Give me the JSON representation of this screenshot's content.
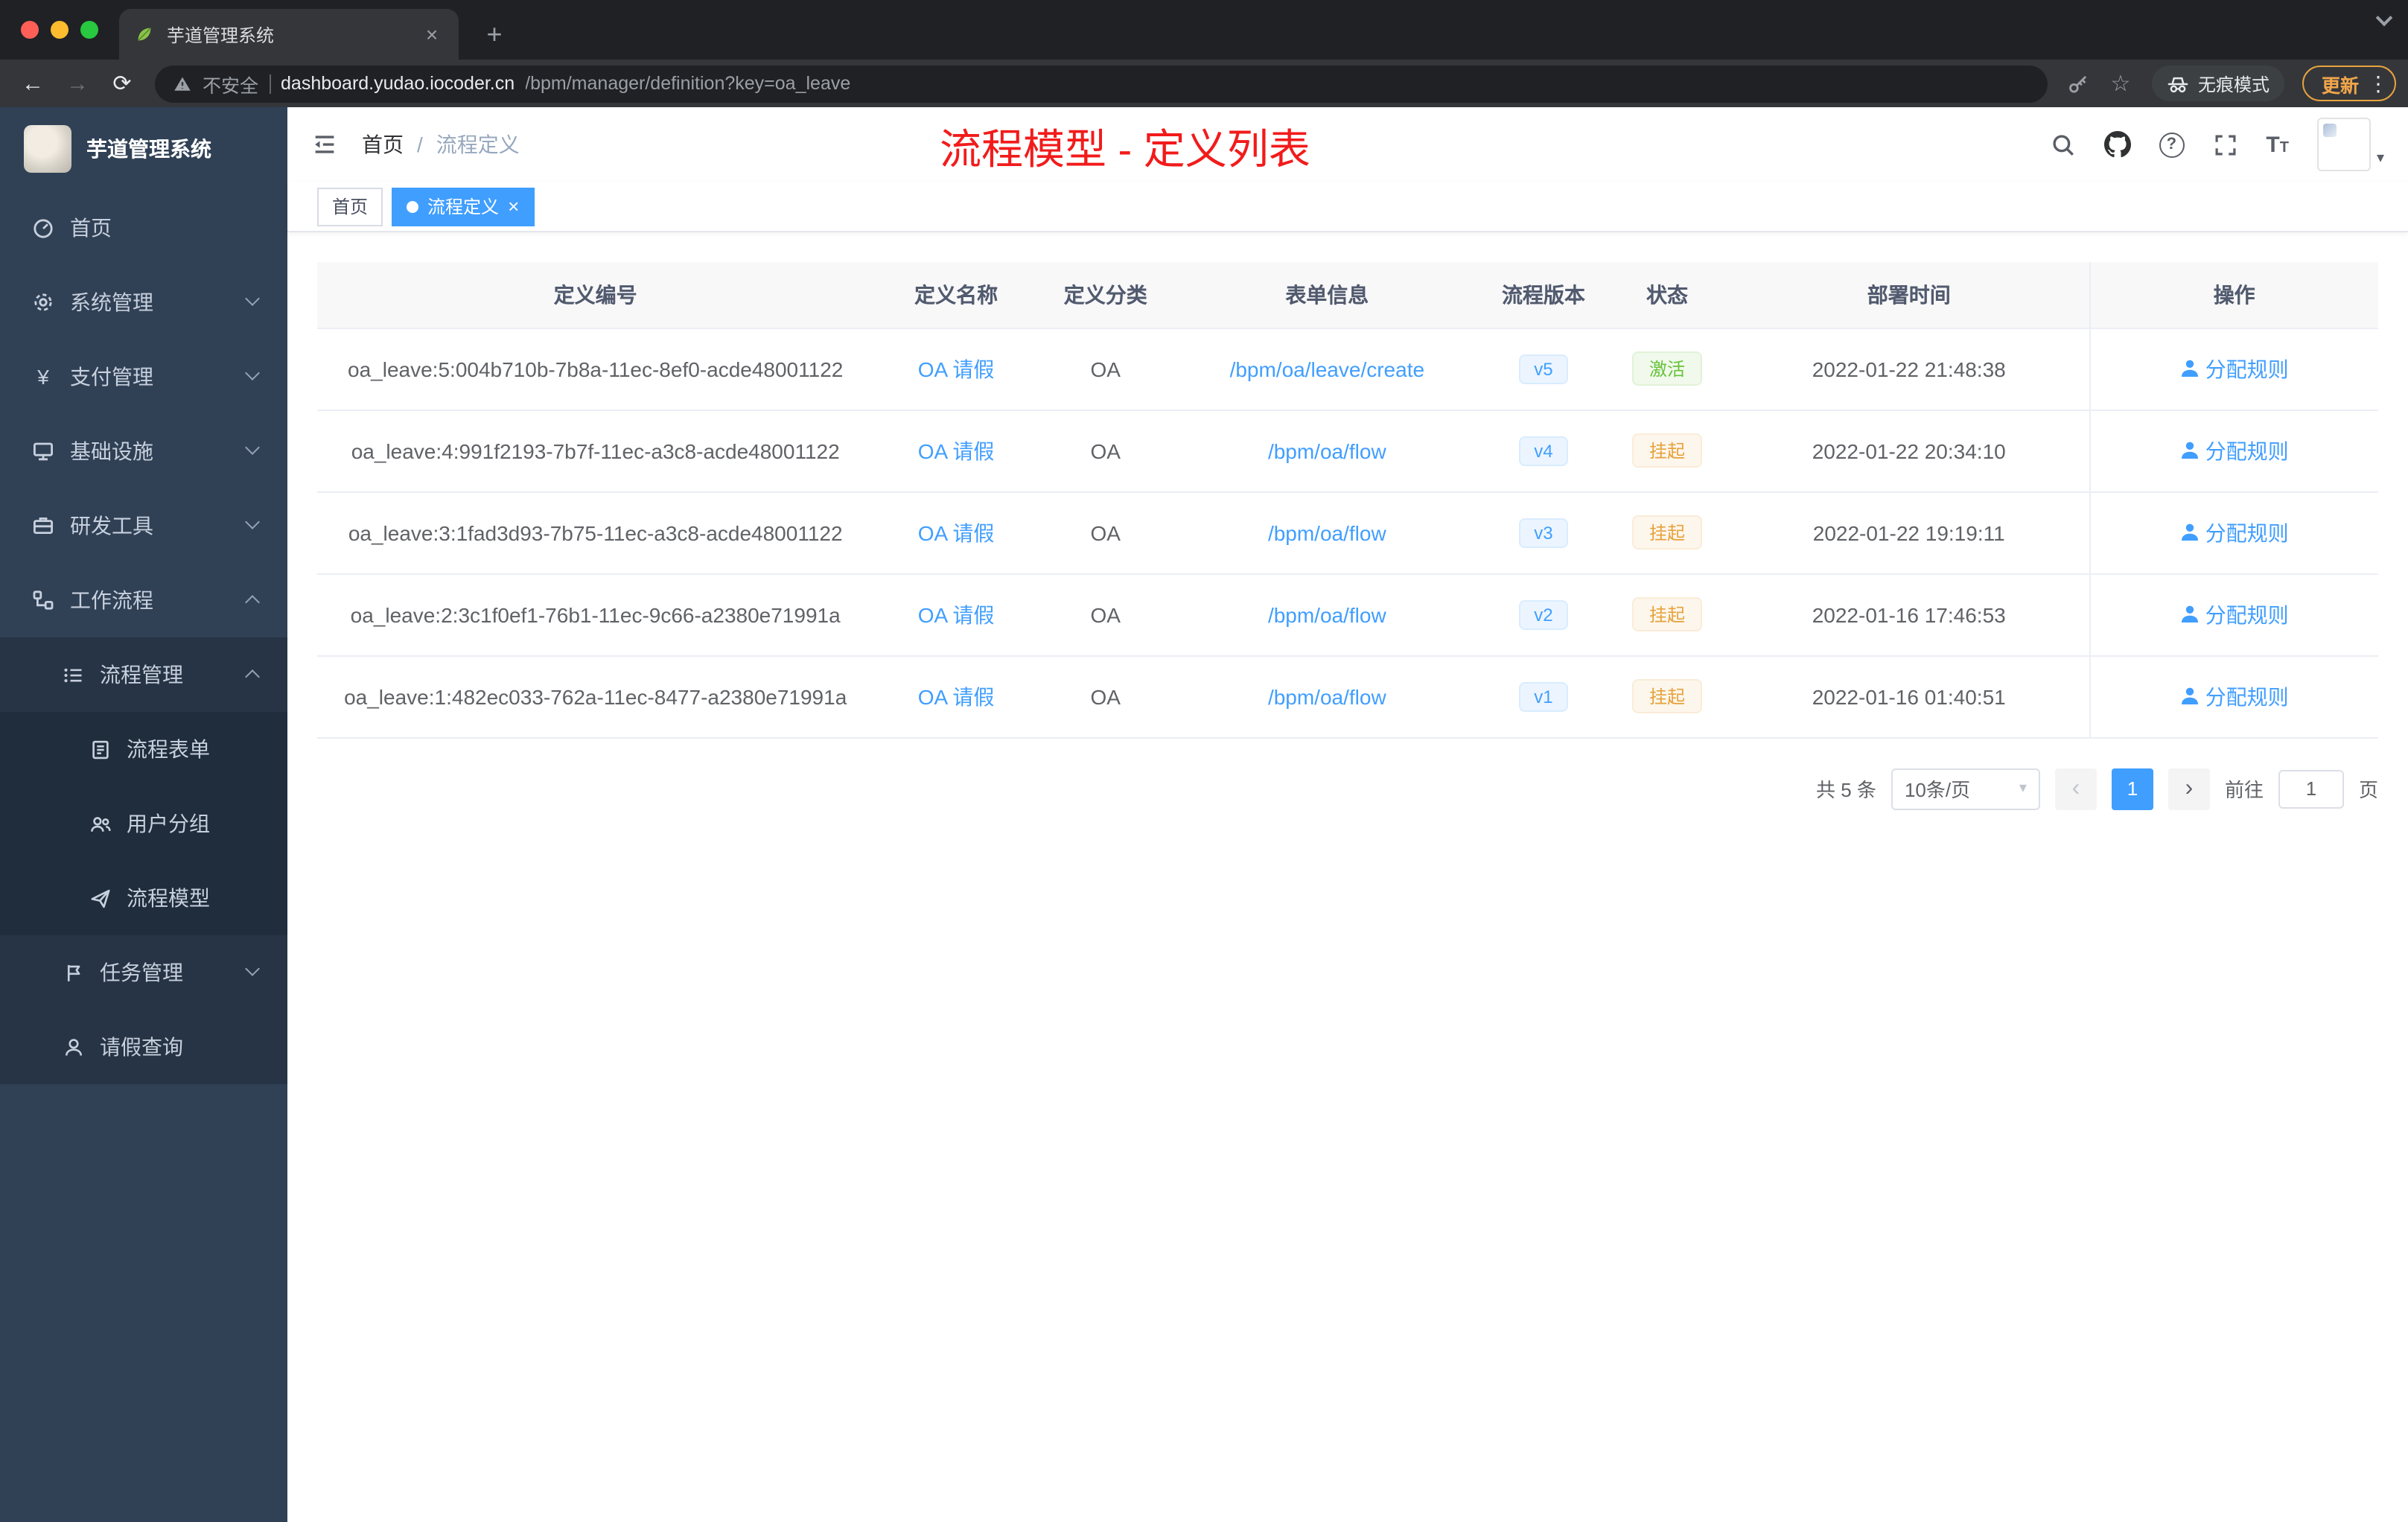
{
  "browser": {
    "tab_title": "芋道管理系统",
    "new_tab": "+",
    "security": "不安全",
    "host": "dashboard.yudao.iocoder.cn",
    "path": "/bpm/manager/definition?key=oa_leave",
    "incognito": "无痕模式",
    "update": "更新"
  },
  "icons": {
    "close": "×",
    "back": "←",
    "forward": "→",
    "reload": "⟳",
    "star": "☆",
    "menu_dots": "⋮",
    "caret_down": "▾",
    "question": "?",
    "yen": "¥",
    "prev": "‹",
    "next": "›",
    "breadcrumb_sep": "/",
    "font_large": "T",
    "font_small": "T"
  },
  "colors": {
    "accent_blue": "#409eff",
    "success_green": "#67c23a",
    "warning_yellow": "#e6a23c",
    "annotation_red": "#f21b1b",
    "sidebar_bg": "#304156"
  },
  "sidebar": {
    "logo_title": "芋道管理系统",
    "items": [
      {
        "label": "首页"
      },
      {
        "label": "系统管理"
      },
      {
        "label": "支付管理"
      },
      {
        "label": "基础设施"
      },
      {
        "label": "研发工具"
      },
      {
        "label": "工作流程"
      },
      {
        "label": "流程管理"
      },
      {
        "label": "流程表单"
      },
      {
        "label": "用户分组"
      },
      {
        "label": "流程模型"
      },
      {
        "label": "任务管理"
      },
      {
        "label": "请假查询"
      }
    ]
  },
  "header": {
    "breadcrumb_home": "首页",
    "breadcrumb_current": "流程定义",
    "annotation": "流程模型 - 定义列表"
  },
  "tags": {
    "home": "首页",
    "active": "流程定义"
  },
  "table": {
    "columns": [
      "定义编号",
      "定义名称",
      "定义分类",
      "表单信息",
      "流程版本",
      "状态",
      "部署时间",
      "操作"
    ],
    "rows": [
      {
        "id": "oa_leave:5:004b710b-7b8a-11ec-8ef0-acde48001122",
        "name": "OA 请假",
        "category": "OA",
        "form": "/bpm/oa/leave/create",
        "version": "v5",
        "status": "激活",
        "status_type": "success",
        "time": "2022-01-22 21:48:38",
        "action": "分配规则"
      },
      {
        "id": "oa_leave:4:991f2193-7b7f-11ec-a3c8-acde48001122",
        "name": "OA 请假",
        "category": "OA",
        "form": "/bpm/oa/flow",
        "version": "v4",
        "status": "挂起",
        "status_type": "warning",
        "time": "2022-01-22 20:34:10",
        "action": "分配规则"
      },
      {
        "id": "oa_leave:3:1fad3d93-7b75-11ec-a3c8-acde48001122",
        "name": "OA 请假",
        "category": "OA",
        "form": "/bpm/oa/flow",
        "version": "v3",
        "status": "挂起",
        "status_type": "warning",
        "time": "2022-01-22 19:19:11",
        "action": "分配规则"
      },
      {
        "id": "oa_leave:2:3c1f0ef1-76b1-11ec-9c66-a2380e71991a",
        "name": "OA 请假",
        "category": "OA",
        "form": "/bpm/oa/flow",
        "version": "v2",
        "status": "挂起",
        "status_type": "warning",
        "time": "2022-01-16 17:46:53",
        "action": "分配规则"
      },
      {
        "id": "oa_leave:1:482ec033-762a-11ec-8477-a2380e71991a",
        "name": "OA 请假",
        "category": "OA",
        "form": "/bpm/oa/flow",
        "version": "v1",
        "status": "挂起",
        "status_type": "warning",
        "time": "2022-01-16 01:40:51",
        "action": "分配规则"
      }
    ]
  },
  "pagination": {
    "total": "共 5 条",
    "size": "10条/页",
    "page": "1",
    "goto_label": "前往",
    "unit": "页",
    "input": "1"
  }
}
